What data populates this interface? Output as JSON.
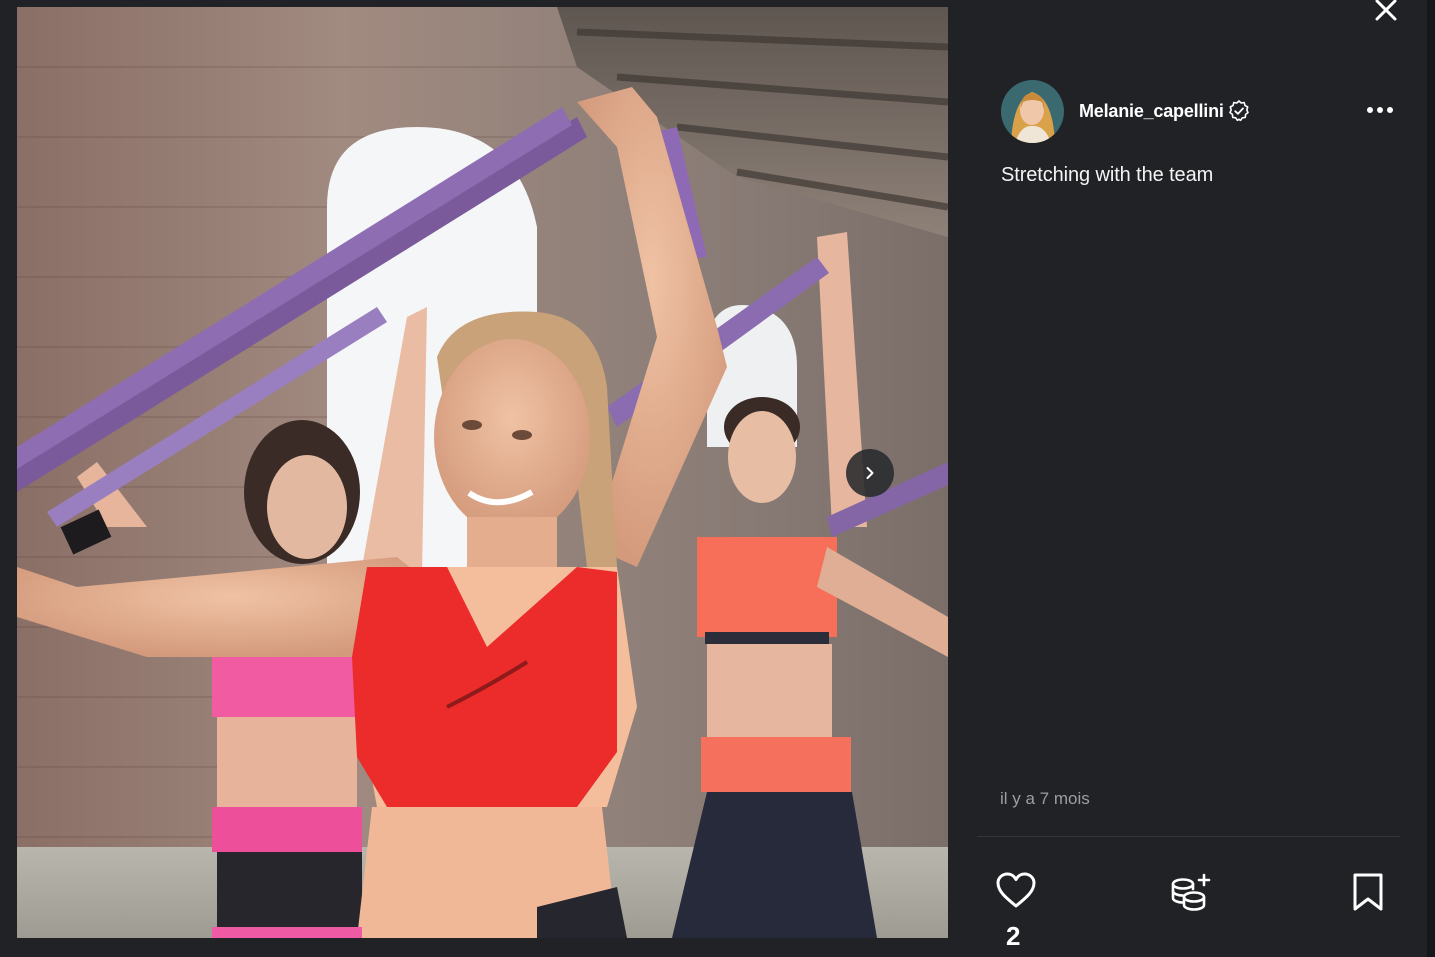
{
  "post": {
    "author": {
      "username": "Melanie_capellini",
      "verified": true,
      "avatar_icon": "avatar-photo"
    },
    "caption": "Stretching with the team",
    "timestamp": "il y a 7 mois",
    "likes": "2",
    "media": {
      "description_icon": "photo-women-stretching-resistance-bands"
    }
  },
  "icons": {
    "close": "close-icon",
    "next": "chevron-right-icon",
    "more": "more-dots-icon",
    "verified": "verified-badge-icon",
    "like": "heart-icon",
    "tip": "coins-plus-icon",
    "save": "bookmark-icon"
  },
  "colors": {
    "panel_bg": "#202226",
    "text_primary": "#ffffff",
    "text_muted": "#9c9ea3",
    "divider": "#34363b"
  }
}
